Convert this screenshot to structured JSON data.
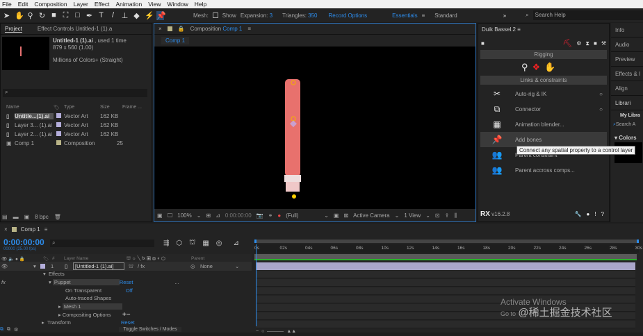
{
  "menu": [
    "File",
    "Edit",
    "Composition",
    "Layer",
    "Effect",
    "Animation",
    "View",
    "Window",
    "Help"
  ],
  "toolbar": {
    "mesh_label": "Mesh:",
    "show_label": "Show",
    "expansion_label": "Expansion:",
    "expansion_value": "3",
    "triangles_label": "Triangles:",
    "triangles_value": "350",
    "record_options": "Record Options",
    "workspace_essentials": "Essentials",
    "workspace_standard": "Standard",
    "search_placeholder": "Search Help"
  },
  "project": {
    "tab_project": "Project",
    "tab_effect_controls": "Effect Controls Untitled-1 (1).a",
    "item_name": "Untitled-1 (1).ai",
    "item_used": ", used 1 time",
    "item_dims": "879 x 560 (1.00)",
    "item_colors": "Millions of Colors+ (Straight)",
    "columns": [
      "Name",
      "Type",
      "Size",
      "Frame ..."
    ],
    "items": [
      {
        "name": "Untitle...(1).ai",
        "type": "Vector Art",
        "size": "162 KB",
        "frame": "",
        "color": "#b4aedb"
      },
      {
        "name": "Layer 3... (1).ai",
        "type": "Vector Art",
        "size": "162 KB",
        "frame": "",
        "color": "#b4aedb"
      },
      {
        "name": "Layer 2... (1).ai",
        "type": "Vector Art",
        "size": "162 KB",
        "frame": "",
        "color": "#b4aedb"
      },
      {
        "name": "Comp 1",
        "type": "Composition",
        "size": "",
        "frame": "25",
        "color": "#b9b487"
      }
    ],
    "bpc": "8 bpc"
  },
  "composition": {
    "tab_label": "Composition",
    "tab_comp": "Comp 1",
    "breadcrumb": "Comp 1",
    "zoom": "100%",
    "timecode": "0:00:00:00",
    "resolution": "(Full)",
    "camera": "Active Camera",
    "views": "1 View"
  },
  "duik": {
    "title": "Duik Bassel.2",
    "section_rigging": "Rigging",
    "section_links": "Links & constraints",
    "items": [
      {
        "label": "Auto-rig & IK",
        "icon": "auto-rig-icon"
      },
      {
        "label": "Connector",
        "icon": "connector-icon"
      },
      {
        "label": "Animation blender...",
        "icon": "blender-icon"
      },
      {
        "label": "Add bones",
        "icon": "pin-icon"
      },
      {
        "label": "Parent constraint",
        "icon": "parent-icon"
      },
      {
        "label": "Parent accross comps...",
        "icon": "parent-comps-icon"
      }
    ],
    "tooltip": "Connect any spatial property to a control layer",
    "version": "v16.2.8"
  },
  "right_panels": {
    "tabs": [
      "Info",
      "Audio",
      "Preview",
      "Effects & I",
      "Align",
      "Librari"
    ],
    "my_library": "My Libra",
    "search": "Search A",
    "colors": "Colors"
  },
  "timeline": {
    "tab": "Comp 1",
    "timecode": "0:00:00:00",
    "fps": "00000 (25.00 fps)",
    "col_layer_name": "Layer Name",
    "col_num": "#",
    "col_parent": "Parent",
    "layer": {
      "index": "1",
      "name": "[Untitled-1 (1).ai]",
      "parent": "None"
    },
    "props": {
      "effects": "Effects",
      "puppet": "Puppet",
      "reset": "Reset",
      "on_transparent": "On Transparent",
      "off": "Off",
      "auto_traced": "Auto-traced Shapes",
      "mesh": "Mesh 1",
      "compositing": "Compositing Options",
      "transform": "Transform",
      "transform_reset": "Reset"
    },
    "toggle": "Toggle Switches / Modes",
    "ticks": [
      "0s",
      "02s",
      "04s",
      "06s",
      "08s",
      "10s",
      "12s",
      "14s",
      "16s",
      "18s",
      "20s",
      "22s",
      "24s",
      "26s",
      "28s",
      "30s"
    ]
  },
  "watermark": {
    "line1": "Activate Windows",
    "line2": "Go to",
    "chinese": "@稀土掘金技术社区"
  }
}
